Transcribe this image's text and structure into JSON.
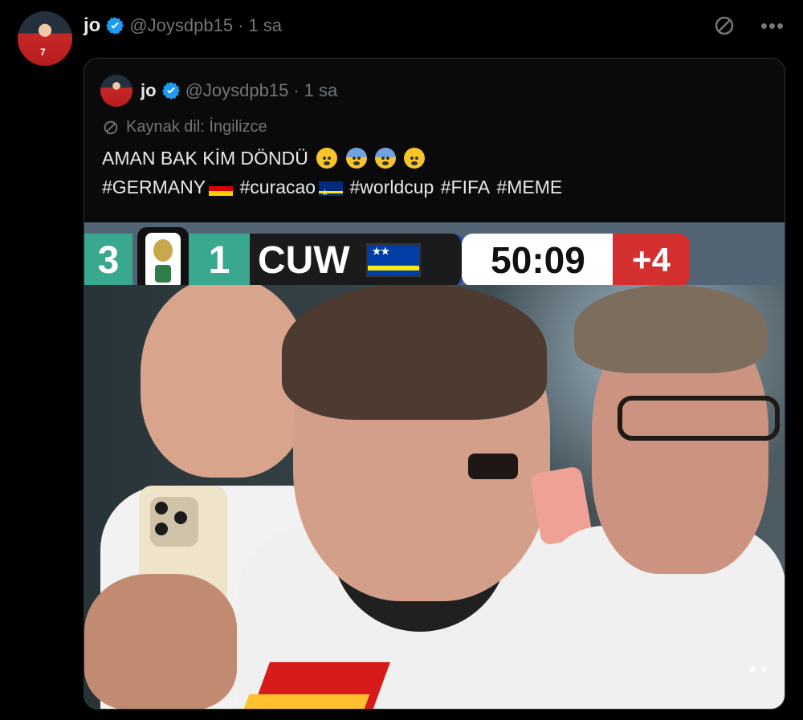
{
  "outer_tweet": {
    "name": "jo",
    "handle": "@Joysdpb15",
    "separator": "·",
    "time": "1 sa"
  },
  "quoted_tweet": {
    "name": "jo",
    "handle": "@Joysdpb15",
    "separator": "·",
    "time": "1 sa",
    "source_language_label": "Kaynak dil: İngilizce",
    "line1_text": "AMAN BAK KİM DÖNDÜ",
    "line2_hashtags": [
      "#GERMANY",
      "#curacao",
      "#worldcup",
      "#FIFA",
      "#MEME"
    ]
  },
  "scoreboard": {
    "home_score": "3",
    "away_score": "1",
    "away_team": "CUW",
    "clock": "50:09",
    "added_time": "+4"
  },
  "icons": {
    "translate": "translate-off-icon",
    "more": "more-icon",
    "verified": "verified-badge-icon"
  },
  "colors": {
    "background": "#000000",
    "text": "#e7e9ea",
    "muted": "#71767b",
    "verified": "#1d9bf0"
  }
}
